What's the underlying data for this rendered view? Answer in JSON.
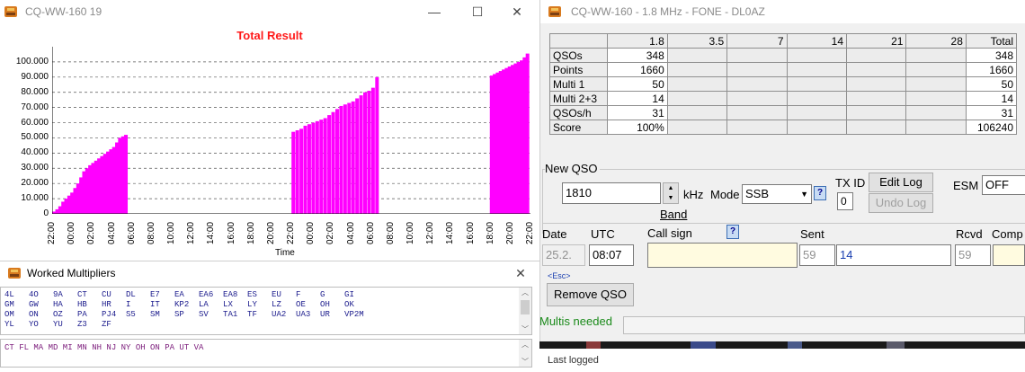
{
  "left_window": {
    "title": "CQ-WW-160 19"
  },
  "win_controls": {
    "minimize": "—",
    "maximize": "☐",
    "close": "✕"
  },
  "chart_data": {
    "type": "bar",
    "title": "Total Result",
    "xlabel": "Time",
    "ylabel": "",
    "ylim": [
      0,
      110000
    ],
    "yticks": [
      "0",
      "10.000",
      "20.000",
      "30.000",
      "40.000",
      "50.000",
      "60.000",
      "70.000",
      "80.000",
      "90.000",
      "100.000"
    ],
    "xticks": [
      "22:00",
      "00:00",
      "02:00",
      "04:00",
      "06:00",
      "08:00",
      "10:00",
      "12:00",
      "14:00",
      "16:00",
      "18:00",
      "20:00",
      "22:00",
      "00:00",
      "02:00",
      "04:00",
      "06:00",
      "08:00",
      "10:00",
      "12:00",
      "14:00",
      "16:00",
      "18:00",
      "20:00",
      "22:00"
    ],
    "series": [
      {
        "x_hours": [
          0.2,
          0.5,
          0.8,
          1.1,
          1.4,
          1.7,
          2.0,
          2.3,
          2.6,
          2.9,
          3.2,
          3.5,
          3.8,
          4.1,
          4.4,
          4.7,
          5.0,
          5.3,
          5.6,
          5.9,
          6.2,
          6.5,
          6.8,
          7.1,
          7.4
        ],
        "values": [
          1500,
          3000,
          5000,
          8000,
          10000,
          12000,
          14000,
          17000,
          20000,
          24000,
          28000,
          30000,
          32000,
          33500,
          35000,
          36500,
          38000,
          39500,
          41000,
          42500,
          44000,
          47000,
          50000,
          51000,
          52000
        ]
      },
      {
        "x_hours": [
          24.2,
          24.6,
          25.0,
          25.4,
          25.8,
          26.2,
          26.6,
          27.0,
          27.4,
          27.8,
          28.2,
          28.6,
          29.0,
          29.4,
          29.8,
          30.2,
          30.6,
          31.0,
          31.4,
          31.8,
          32.2,
          32.6
        ],
        "values": [
          54000,
          55000,
          56000,
          58000,
          59000,
          60000,
          61000,
          62000,
          63000,
          65000,
          67000,
          69000,
          71000,
          72000,
          73000,
          74000,
          76000,
          78000,
          80000,
          81000,
          83000,
          90000
        ]
      },
      {
        "x_hours": [
          44.1,
          44.4,
          44.7,
          45.0,
          45.3,
          45.6,
          45.9,
          46.2,
          46.5,
          46.8,
          47.1,
          47.4,
          47.7
        ],
        "values": [
          91000,
          92000,
          93000,
          94000,
          95000,
          96000,
          97000,
          98000,
          99000,
          100000,
          101000,
          103000,
          105500
        ]
      }
    ]
  },
  "multipliers_window": {
    "title": "Worked Multipliers",
    "rows": [
      "4L   4O   9A   CT   CU   DL   E7   EA   EA6  EA8  ES   EU   F    G    GI",
      "GM   GW   HA   HB   HR   I    IT   KP2  LA   LX   LY   LZ   OE   OH   OK",
      "OM   ON   OZ   PA   PJ4  S5   SM   SP   SV   TA1  TF   UA2  UA3  UR   VP2M",
      "YL   YO   YU   Z3   ZF"
    ],
    "states": "CT FL MA MD MI MN NH NJ NY OH ON PA UT VA"
  },
  "right_window": {
    "title": "CQ-WW-160 -  1.8 MHz - FONE  -  DL0AZ"
  },
  "score_table": {
    "headers": [
      "",
      "1.8",
      "3.5",
      "7",
      "14",
      "21",
      "28",
      "Total"
    ],
    "rows": [
      {
        "label": "QSOs",
        "b18": "348",
        "total": "348"
      },
      {
        "label": "Points",
        "b18": "1660",
        "total": "1660"
      },
      {
        "label": "Multi 1",
        "b18": "50",
        "total": "50"
      },
      {
        "label": "Multi 2+3",
        "b18": "14",
        "total": "14"
      },
      {
        "label": "QSOs/h",
        "b18": "31",
        "total": "31"
      },
      {
        "label": "Score",
        "b18": "100%",
        "total": "106240"
      }
    ]
  },
  "new_qso": {
    "group_label": "New QSO",
    "freq": "1810",
    "khz": "kHz",
    "band": "Band",
    "mode_label": "Mode",
    "mode_value": "SSB",
    "help": "?",
    "tx_id_label": "TX ID",
    "tx_id_value": "0",
    "edit_log": "Edit Log",
    "undo_log": "Undo Log",
    "esm_label": "ESM",
    "esm_value": "OFF",
    "date_label": "Date",
    "date_value": "25.2.",
    "utc_label": "UTC",
    "utc_value": "08:07",
    "callsign_label": "Call sign",
    "sent_label": "Sent",
    "sent_rst": "59",
    "sent_zone": "14",
    "rcvd_label": "Rcvd",
    "rcvd_rst": "59",
    "comp_label": "Comp",
    "esc_hint": "<Esc>",
    "remove_qso": "Remove QSO",
    "multis_needed": "Multis needed",
    "last_logged": "Last logged"
  }
}
